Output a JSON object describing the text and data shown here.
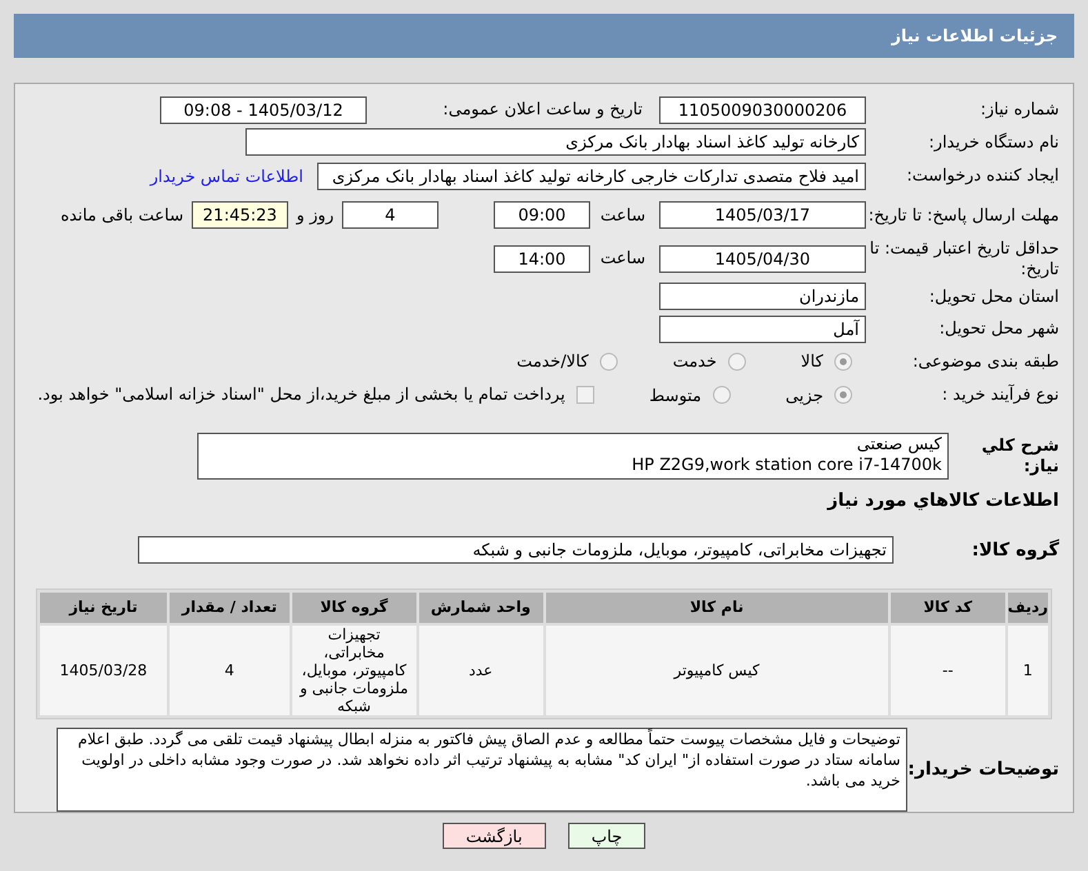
{
  "header": {
    "title": "جزئیات اطلاعات نیاز"
  },
  "need_number": {
    "label": "شماره نیاز:",
    "value": "1105009030000206"
  },
  "announce": {
    "label": "تاریخ و ساعت اعلان عمومی:",
    "value": "1405/03/12 - 09:08"
  },
  "buyer_org": {
    "label": "نام دستگاه خریدار:",
    "value": "کارخانه تولید کاغذ اسناد بهادار بانک مرکزی"
  },
  "requester": {
    "label": "ایجاد کننده درخواست:",
    "value": "امید فلاح متصدی تدارکات خارجی کارخانه تولید کاغذ اسناد بهادار بانک مرکزی",
    "link": "اطلاعات تماس خریدار"
  },
  "deadline": {
    "label": "مهلت ارسال پاسخ: تا تاریخ:",
    "date": "1405/03/17",
    "time_label": "ساعت",
    "time": "09:00",
    "days": "4",
    "days_label": "روز و",
    "remaining": "21:45:23",
    "remaining_label": "ساعت باقی مانده"
  },
  "validity": {
    "label": "حداقل تاریخ اعتبار قیمت: تا تاریخ:",
    "date": "1405/04/30",
    "time_label": "ساعت",
    "time": "14:00"
  },
  "province": {
    "label": "استان محل تحویل:",
    "value": "مازندران"
  },
  "city": {
    "label": "شهر محل تحویل:",
    "value": "آمل"
  },
  "category": {
    "label": "طبقه بندی موضوعی:",
    "options": [
      {
        "label": "کالا",
        "selected": true
      },
      {
        "label": "خدمت",
        "selected": false
      },
      {
        "label": "کالا/خدمت",
        "selected": false
      }
    ]
  },
  "process": {
    "label": "نوع فرآیند خرید :",
    "options": [
      {
        "label": "جزیی",
        "selected": true
      },
      {
        "label": "متوسط",
        "selected": false
      }
    ],
    "payment": {
      "label": "پرداخت تمام یا بخشی از مبلغ خرید،از محل \"اسناد خزانه اسلامی\" خواهد بود.",
      "checked": false
    }
  },
  "description": {
    "label": "شرح کلي نياز:",
    "lines": [
      "کیس صنعتی",
      "HP Z2G9,work station core i7-14700k"
    ]
  },
  "goods_title": "اطلاعات کالاهاي مورد نياز",
  "goods_group": {
    "label": "گروه کالا:",
    "value": "تجهیزات مخابراتی، کامپیوتر، موبایل، ملزومات جانبی و شبکه"
  },
  "table": {
    "columns": [
      "ردیف",
      "کد کالا",
      "نام کالا",
      "واحد شمارش",
      "گروه کالا",
      "تعداد / مقدار",
      "تاریخ نیاز"
    ],
    "rows": [
      [
        "1",
        "--",
        "کیس کامپیوتر",
        "عدد",
        "تجهیزات مخابراتی، کامپیوتر، موبایل، ملزومات جانبی و شبکه",
        "4",
        "1405/03/28"
      ]
    ]
  },
  "notes": {
    "label": "توضیحات خریدار:",
    "value": "توضیحات و فایل مشخصات پیوست حتماً مطالعه و عدم الصاق پیش فاکتور به منزله ابطال پیشنهاد قیمت تلقی می گردد. طبق اعلام سامانه ستاد در صورت استفاده از\" ایران کد\" مشابه به پیشنهاد ترتیب اثر داده نخواهد شد. در صورت وجود مشابه داخلی در اولویت خرید می باشد."
  },
  "buttons": [
    {
      "label": "چاپ",
      "kind": "print"
    },
    {
      "label": "بازگشت",
      "kind": "back"
    }
  ]
}
